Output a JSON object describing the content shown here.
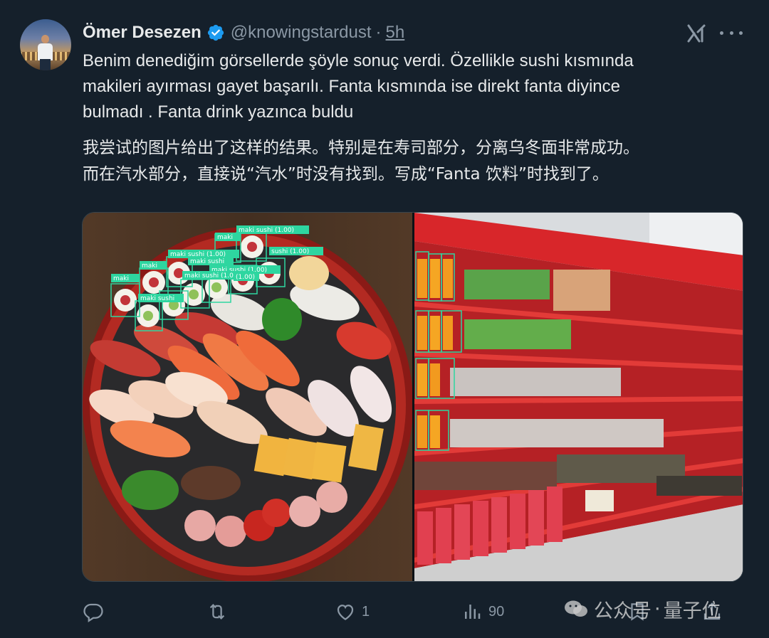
{
  "author": {
    "name": "Ömer Desezen",
    "handle": "@knowingstardust",
    "separator": "·",
    "time": "5h"
  },
  "post": {
    "text_tr": "Benim denediğim görsellerde şöyle sonuç verdi. Özellikle sushi kısmında\nmakileri ayırması gayet başarılı. Fanta kısmında ise direkt fanta diyince\nbulmadı . Fanta drink yazınca buldu",
    "text_zh": "我尝试的图片给出了这样的结果。特别是在寿司部分，分离乌冬面非常成功。\n而在汽水部分，直接说“汽水”时没有找到。写成“Fanta 饮料”时找到了。"
  },
  "media": {
    "sushi_labels": [
      "maki",
      "maki sushi (1.00)",
      "maki sushi (1.00)",
      "sushi (1.00)",
      "maki sushi (1.00)",
      "maki",
      "maki",
      "maki sushi (1.00)",
      "maki sushi",
      "maki sushi",
      "(1.00)"
    ]
  },
  "actions": {
    "reply_count": "",
    "retweet_count": "",
    "like_count": "1",
    "views_count": "90"
  },
  "watermark": {
    "left": "公众号",
    "sep": "·",
    "right": "量子位"
  },
  "icons": [
    "verified-badge-icon",
    "grok-icon",
    "more-icon",
    "reply-icon",
    "retweet-icon",
    "like-icon",
    "views-icon",
    "bookmark-icon",
    "share-icon",
    "wechat-icon"
  ],
  "colors": {
    "background": "#15202b",
    "text": "#e7e9ea",
    "muted": "#8b98a5",
    "verified": "#1d9bf0",
    "detection_box": "#2ed6a0"
  }
}
